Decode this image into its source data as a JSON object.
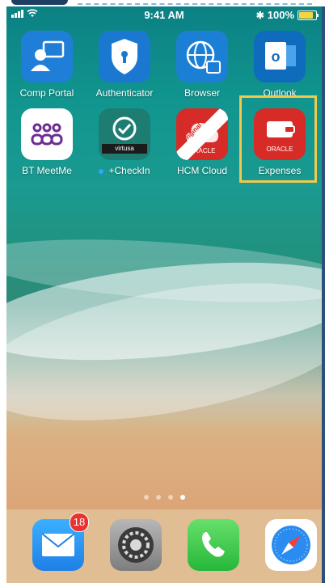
{
  "status_bar": {
    "time": "9:41 AM",
    "battery": "100%"
  },
  "apps_row1": [
    {
      "label": "Comp Portal",
      "icon": "comp-portal-icon",
      "color": "#1f7fd8"
    },
    {
      "label": "Authenticator",
      "icon": "authenticator-icon",
      "color": "#1a78d1"
    },
    {
      "label": "Browser",
      "icon": "browser-icon",
      "color": "#1c7fd6"
    },
    {
      "label": "Outlook",
      "icon": "outlook-icon",
      "color": "#0f6cbd"
    }
  ],
  "apps_row2": [
    {
      "label": "BT MeetMe",
      "icon": "bt-meetme-icon",
      "color": "#ffffff"
    },
    {
      "label": "+CheckIn",
      "icon": "checkin-icon",
      "color": "#1d7d73",
      "sublabel": "virtusa"
    },
    {
      "label": "HCM Cloud",
      "icon": "hcm-cloud-icon",
      "color": "#d62b26",
      "ribbon": "Original",
      "brand": "ORACLE"
    },
    {
      "label": "Expenses",
      "icon": "expenses-icon",
      "color": "#d62b26",
      "brand": "ORACLE"
    }
  ],
  "dock": [
    {
      "label": "Mail",
      "icon": "mail-icon",
      "badge": "18"
    },
    {
      "label": "Settings",
      "icon": "settings-icon"
    },
    {
      "label": "Phone",
      "icon": "phone-icon"
    },
    {
      "label": "Safari",
      "icon": "safari-icon"
    }
  ]
}
